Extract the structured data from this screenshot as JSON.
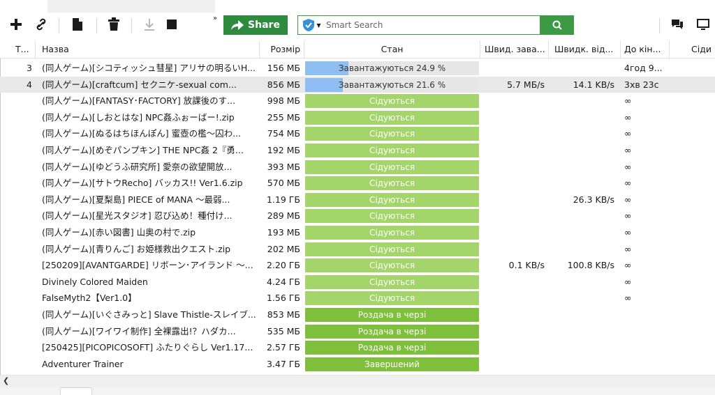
{
  "toolbar": {
    "add_icon": "plus-icon",
    "link_icon": "link-icon",
    "file_icon": "file-icon",
    "delete_icon": "trash-icon",
    "download_icon": "download-icon",
    "stop_icon": "stop-icon",
    "more_icon": "chevron-more-icon",
    "share_label": "Share",
    "search_placeholder": "Smart Search",
    "chat_icon": "chat-icon",
    "monitor_icon": "monitor-icon"
  },
  "columns": {
    "num": "Т...",
    "name": "Назва",
    "size": "Розмір",
    "status": "Стан",
    "down": "Швид. зава...",
    "up": "Швидк. від...",
    "eta": "До кін...",
    "seeds": "Сіди"
  },
  "rows": [
    {
      "num": "3",
      "name": "(同人ゲーム)[シコティッシュ彗星] アリサの明るいH...",
      "size": "156 МБ",
      "status": "Завантажуються 24.9 %",
      "kind": "download",
      "progress": 0.249,
      "down": "",
      "up": "",
      "eta": "4год 9..."
    },
    {
      "num": "4",
      "name": "(同人ゲーム)[craftcum] セクニケ-sexual com...",
      "size": "856 МБ",
      "status": "Завантажуються 21.6 %",
      "kind": "download",
      "progress": 0.216,
      "down": "5.7 МБ/s",
      "up": "14.1 KB/s",
      "eta": "3хв 23с"
    },
    {
      "num": "",
      "name": "(同人ゲーム)[FANTASY･FACTORY] 放課後のす...",
      "size": "998 МБ",
      "status": "Сідуються",
      "kind": "seed",
      "down": "",
      "up": "",
      "eta": "∞"
    },
    {
      "num": "",
      "name": "(同人ゲーム)[しおとはな] NPC姦ふぉーばー!.zip",
      "size": "255 МБ",
      "status": "Сідуються",
      "kind": "seed",
      "down": "",
      "up": "",
      "eta": "∞"
    },
    {
      "num": "",
      "name": "(同人ゲーム)[ぬるはちほんぽん] 蜜壺の檻～囚わ...",
      "size": "754 МБ",
      "status": "Сідуються",
      "kind": "seed",
      "down": "",
      "up": "",
      "eta": "∞"
    },
    {
      "num": "",
      "name": "(同人ゲーム)[めぞパンプキン] THE NPC姦 2『勇...",
      "size": "192 МБ",
      "status": "Сідуються",
      "kind": "seed",
      "down": "",
      "up": "",
      "eta": "∞"
    },
    {
      "num": "",
      "name": "(同人ゲーム)[ゆどうふ研究所] 愛奈の欲望開放...",
      "size": "393 МБ",
      "status": "Сідуються",
      "kind": "seed",
      "down": "",
      "up": "",
      "eta": "∞"
    },
    {
      "num": "",
      "name": "(同人ゲーム)[サトウRecho] バッカス!! Ver1.6.zip",
      "size": "570 МБ",
      "status": "Сідуються",
      "kind": "seed",
      "down": "",
      "up": "",
      "eta": "∞"
    },
    {
      "num": "",
      "name": "(同人ゲーム)[夏梨島] PIECE of MANA ～最弱...",
      "size": "1.19 ГБ",
      "status": "Сідуються",
      "kind": "seed",
      "down": "",
      "up": "26.3 KB/s",
      "eta": "∞"
    },
    {
      "num": "",
      "name": "(同人ゲーム)[星光スタジオ] 忍び込め！種付け...",
      "size": "289 МБ",
      "status": "Сідуються",
      "kind": "seed",
      "down": "",
      "up": "",
      "eta": "∞"
    },
    {
      "num": "",
      "name": "(同人ゲーム)[赤い図書] 山奥の村で.zip",
      "size": "193 МБ",
      "status": "Сідуються",
      "kind": "seed",
      "down": "",
      "up": "",
      "eta": "∞"
    },
    {
      "num": "",
      "name": "(同人ゲーム)[青りんご] お姫様救出クエスト.zip",
      "size": "202 МБ",
      "status": "Сідуються",
      "kind": "seed",
      "down": "",
      "up": "",
      "eta": "∞"
    },
    {
      "num": "",
      "name": "[250209][AVANTGARDE] リボーン･アイランド ～...",
      "size": "2.20 ГБ",
      "status": "Сідуються",
      "kind": "seed",
      "down": "0.1 KB/s",
      "up": "100.8 KB/s",
      "eta": "∞"
    },
    {
      "num": "",
      "name": "Divinely Colored Maiden",
      "size": "4.24 ГБ",
      "status": "Сідуються",
      "kind": "seed",
      "down": "",
      "up": "",
      "eta": "∞"
    },
    {
      "num": "",
      "name": "FalseMyth2【Ver1.0】",
      "size": "1.56 ГБ",
      "status": "Сідуються",
      "kind": "seed",
      "down": "",
      "up": "",
      "eta": "∞"
    },
    {
      "num": "",
      "name": "(同人ゲーム)[いぐさみっと] Slave Thistle-スレイブ...",
      "size": "853 МБ",
      "status": "Роздача в черзі",
      "kind": "queue",
      "down": "",
      "up": "",
      "eta": ""
    },
    {
      "num": "",
      "name": "(同人ゲーム)[ワイワイ制作] 全裸露出!？ハダカ...",
      "size": "535 МБ",
      "status": "Роздача в черзі",
      "kind": "queue",
      "down": "",
      "up": "",
      "eta": ""
    },
    {
      "num": "",
      "name": "[250425][PICOPICOSOFT] ふたりぐらし Ver1.17...",
      "size": "2.57 ГБ",
      "status": "Роздача в черзі",
      "kind": "queue",
      "down": "",
      "up": "",
      "eta": ""
    },
    {
      "num": "",
      "name": "Adventurer Trainer",
      "size": "3.47 ГБ",
      "status": "Завершений",
      "kind": "done",
      "down": "",
      "up": "",
      "eta": ""
    }
  ],
  "colors": {
    "accent_green": "#3c9a45",
    "share_green": "#2e8b3e",
    "seed_green": "#a4d56b",
    "queue_green": "#7ebf3b",
    "progress_blue": "#8fbff2"
  }
}
